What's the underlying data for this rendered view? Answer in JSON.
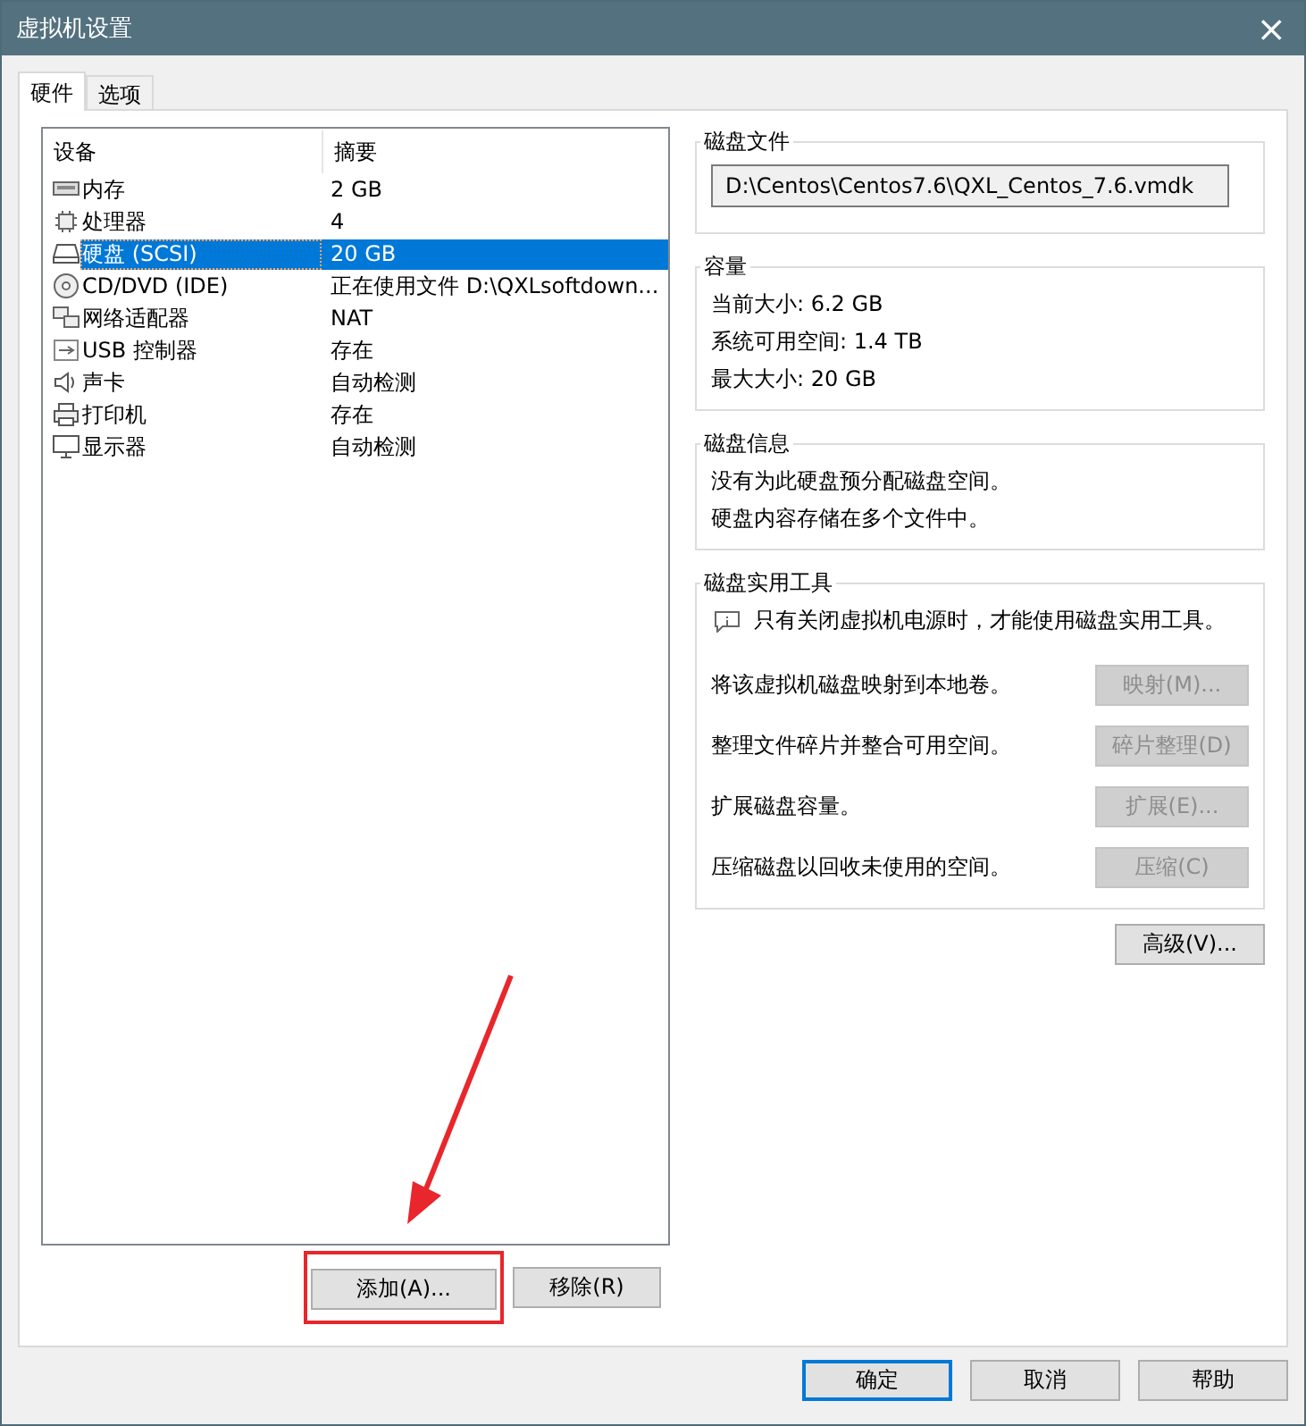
{
  "window": {
    "title": "虚拟机设置",
    "close": "×"
  },
  "tabs": [
    {
      "label": "硬件",
      "selected": true
    },
    {
      "label": "选项",
      "selected": false
    }
  ],
  "device_table": {
    "columns": [
      "设备",
      "摘要"
    ],
    "rows": [
      {
        "kind": "memory",
        "device": "内存",
        "summary": "2 GB",
        "selected": false
      },
      {
        "kind": "cpu",
        "device": "处理器",
        "summary": "4",
        "selected": false
      },
      {
        "kind": "disk",
        "device": "硬盘 (SCSI)",
        "summary": "20 GB",
        "selected": true
      },
      {
        "kind": "cdrom",
        "device": "CD/DVD (IDE)",
        "summary": "正在使用文件 D:\\QXLsoftdown...",
        "selected": false
      },
      {
        "kind": "network",
        "device": "网络适配器",
        "summary": "NAT",
        "selected": false
      },
      {
        "kind": "usb",
        "device": "USB 控制器",
        "summary": "存在",
        "selected": false
      },
      {
        "kind": "sound",
        "device": "声卡",
        "summary": "自动检测",
        "selected": false
      },
      {
        "kind": "printer",
        "device": "打印机",
        "summary": "存在",
        "selected": false
      },
      {
        "kind": "display",
        "device": "显示器",
        "summary": "自动检测",
        "selected": false
      }
    ]
  },
  "device_buttons": [
    {
      "label": "添加(A)...",
      "highlighted": true
    },
    {
      "label": "移除(R)",
      "highlighted": false
    }
  ],
  "disk_file": {
    "title": "磁盘文件",
    "value": "D:\\Centos\\Centos7.6\\QXL_Centos_7.6.vmdk"
  },
  "capacity": {
    "title": "容量",
    "lines": [
      "当前大小: 6.2 GB",
      "系统可用空间: 1.4 TB",
      "最大大小: 20 GB"
    ]
  },
  "disk_info": {
    "title": "磁盘信息",
    "lines": [
      "没有为此硬盘预分配磁盘空间。",
      "硬盘内容存储在多个文件中。"
    ]
  },
  "disk_utilities": {
    "title": "磁盘实用工具",
    "notice": "只有关闭虚拟机电源时，才能使用磁盘实用工具。",
    "actions": [
      {
        "description": "将该虚拟机磁盘映射到本地卷。",
        "button": "映射(M)...",
        "disabled": true
      },
      {
        "description": "整理文件碎片并整合可用空间。",
        "button": "碎片整理(D)",
        "disabled": true
      },
      {
        "description": "扩展磁盘容量。",
        "button": "扩展(E)...",
        "disabled": true
      },
      {
        "description": "压缩磁盘以回收未使用的空间。",
        "button": "压缩(C)",
        "disabled": true
      }
    ]
  },
  "advanced_button": "高级(V)...",
  "footer_buttons": [
    {
      "label": "确定",
      "default": true
    },
    {
      "label": "取消",
      "default": false
    },
    {
      "label": "帮助",
      "default": false
    }
  ]
}
